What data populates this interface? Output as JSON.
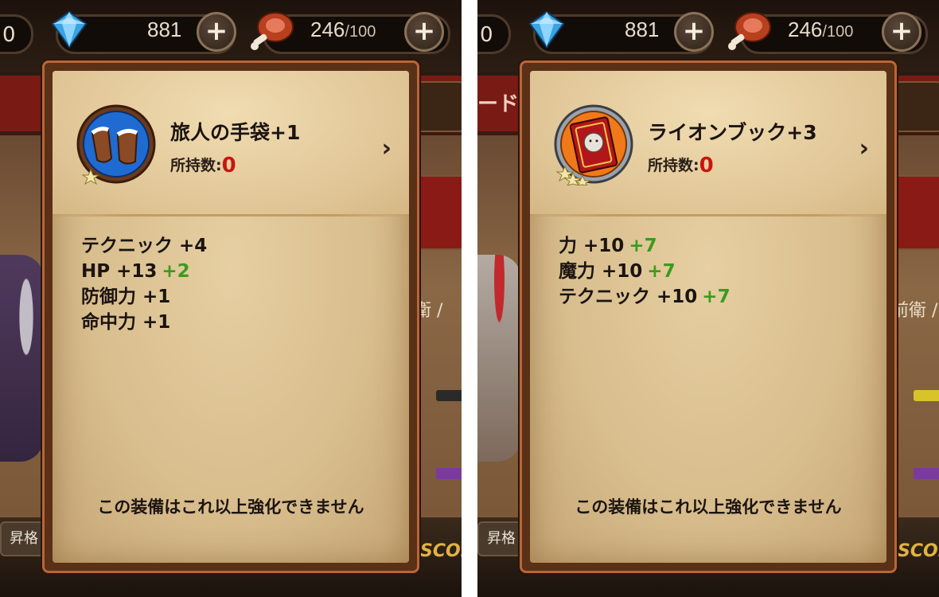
{
  "panels": [
    {
      "currency": {
        "left_value": "0",
        "gems": "881",
        "stamina_current": "246",
        "stamina_max": "/100"
      },
      "item": {
        "name": "旅人の手袋+1",
        "owned_label": "所持数:",
        "owned_count": "0",
        "stars": 1,
        "icon": "gloves-icon"
      },
      "stats": [
        {
          "label": "テクニック +4",
          "bonus": ""
        },
        {
          "label": "HP +13",
          "bonus": "+2"
        },
        {
          "label": "防御力 +1",
          "bonus": ""
        },
        {
          "label": "命中力 +1",
          "bonus": ""
        }
      ],
      "message": "この装備はこれ以上強化できません",
      "background": {
        "side_text": "衛 /",
        "bottom_left_label": "昇格",
        "score_text": "SCOR",
        "red_tab_text": ""
      }
    },
    {
      "currency": {
        "left_value": "0",
        "gems": "881",
        "stamina_current": "246",
        "stamina_max": "/100"
      },
      "item": {
        "name": "ライオンブック+3",
        "owned_label": "所持数:",
        "owned_count": "0",
        "stars": 3,
        "icon": "lion-book-icon"
      },
      "stats": [
        {
          "label": "力 +10",
          "bonus": "+7"
        },
        {
          "label": "魔力 +10",
          "bonus": "+7"
        },
        {
          "label": "テクニック +10",
          "bonus": "+7"
        }
      ],
      "message": "この装備はこれ以上強化できません",
      "background": {
        "side_text": "前衛 /",
        "bottom_left_label": "昇格",
        "score_text": "SCOR",
        "red_tab_text": "ード"
      }
    }
  ],
  "colors": {
    "bonus_green": "#3c9a1f",
    "count_red": "#c8160f",
    "parchment": "#e2c898"
  }
}
